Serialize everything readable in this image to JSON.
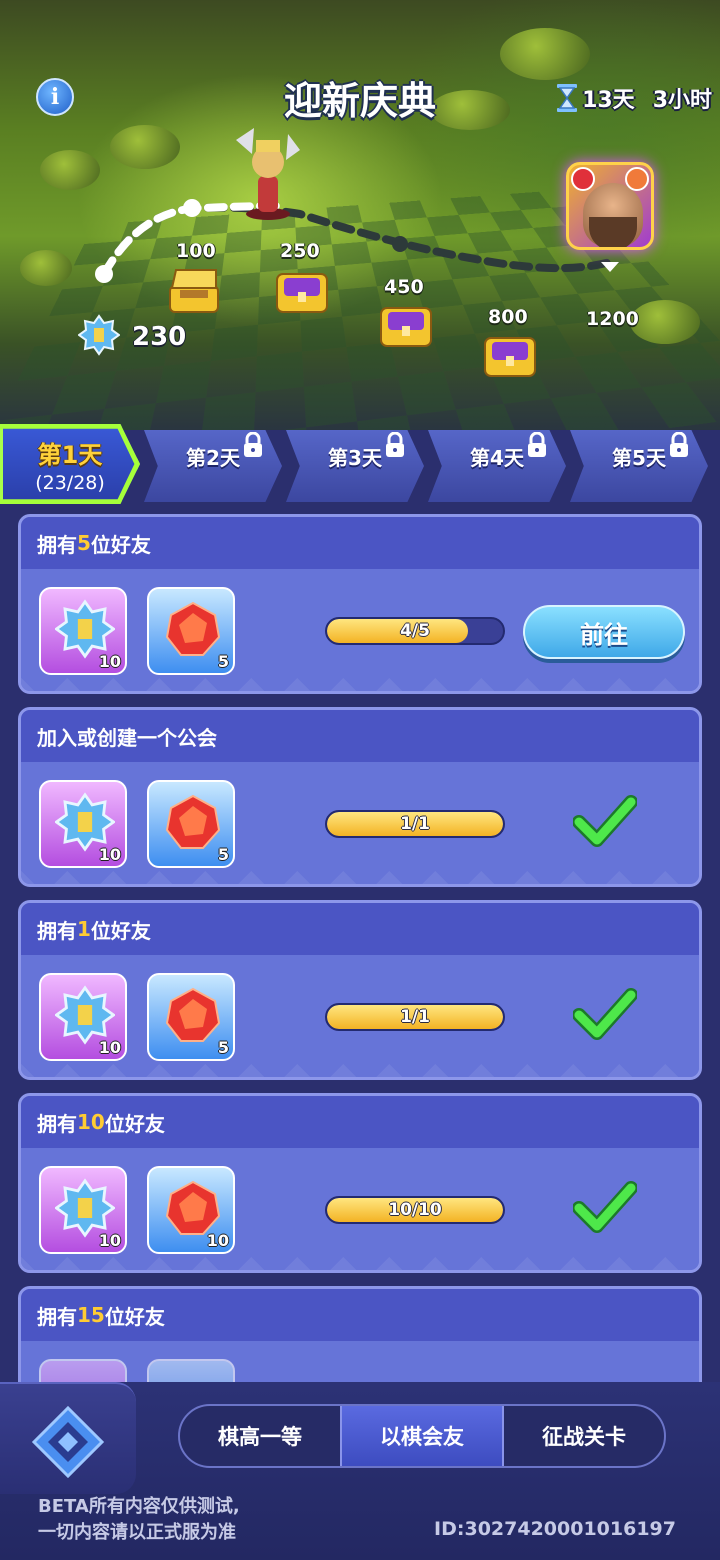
{
  "event": {
    "title": "迎新庆典",
    "timer_days": "13天",
    "timer_hours": "3小时",
    "points": "230",
    "milestones": [
      "100",
      "250",
      "450",
      "800",
      "1200"
    ]
  },
  "days": [
    {
      "label": "第1天",
      "progress": "(23/28)",
      "locked": false
    },
    {
      "label": "第2天",
      "locked": true
    },
    {
      "label": "第3天",
      "locked": true
    },
    {
      "label": "第4天",
      "locked": true
    },
    {
      "label": "第5天",
      "locked": true
    }
  ],
  "tasks": [
    {
      "title_pre": "拥有",
      "title_num": "5",
      "title_post": "位好友",
      "reward1": "10",
      "reward2": "5",
      "progress_text": "4/5",
      "progress": 0.8,
      "action": "前往",
      "done": false
    },
    {
      "title_pre": "加入或创建一个公会",
      "title_num": "",
      "title_post": "",
      "reward1": "10",
      "reward2": "5",
      "progress_text": "1/1",
      "progress": 1.0,
      "done": true
    },
    {
      "title_pre": "拥有",
      "title_num": "1",
      "title_post": "位好友",
      "reward1": "10",
      "reward2": "5",
      "progress_text": "1/1",
      "progress": 1.0,
      "done": true
    },
    {
      "title_pre": "拥有",
      "title_num": "10",
      "title_post": "位好友",
      "reward1": "10",
      "reward2": "10",
      "progress_text": "10/10",
      "progress": 1.0,
      "done": true
    },
    {
      "title_pre": "拥有",
      "title_num": "15",
      "title_post": "位好友"
    }
  ],
  "nav": {
    "items": [
      "棋高一等",
      "以棋会友",
      "征战关卡"
    ],
    "active_index": 1
  },
  "footer": {
    "note_line1": "BETA所有内容仅供测试,",
    "note_line2": "一切内容请以正式服为准",
    "player_id": "ID:3027420001016197"
  },
  "colors": {
    "highlight": "#ffcc33",
    "active_tab_border": "#a6ff3a",
    "check": "#4ee84a"
  }
}
